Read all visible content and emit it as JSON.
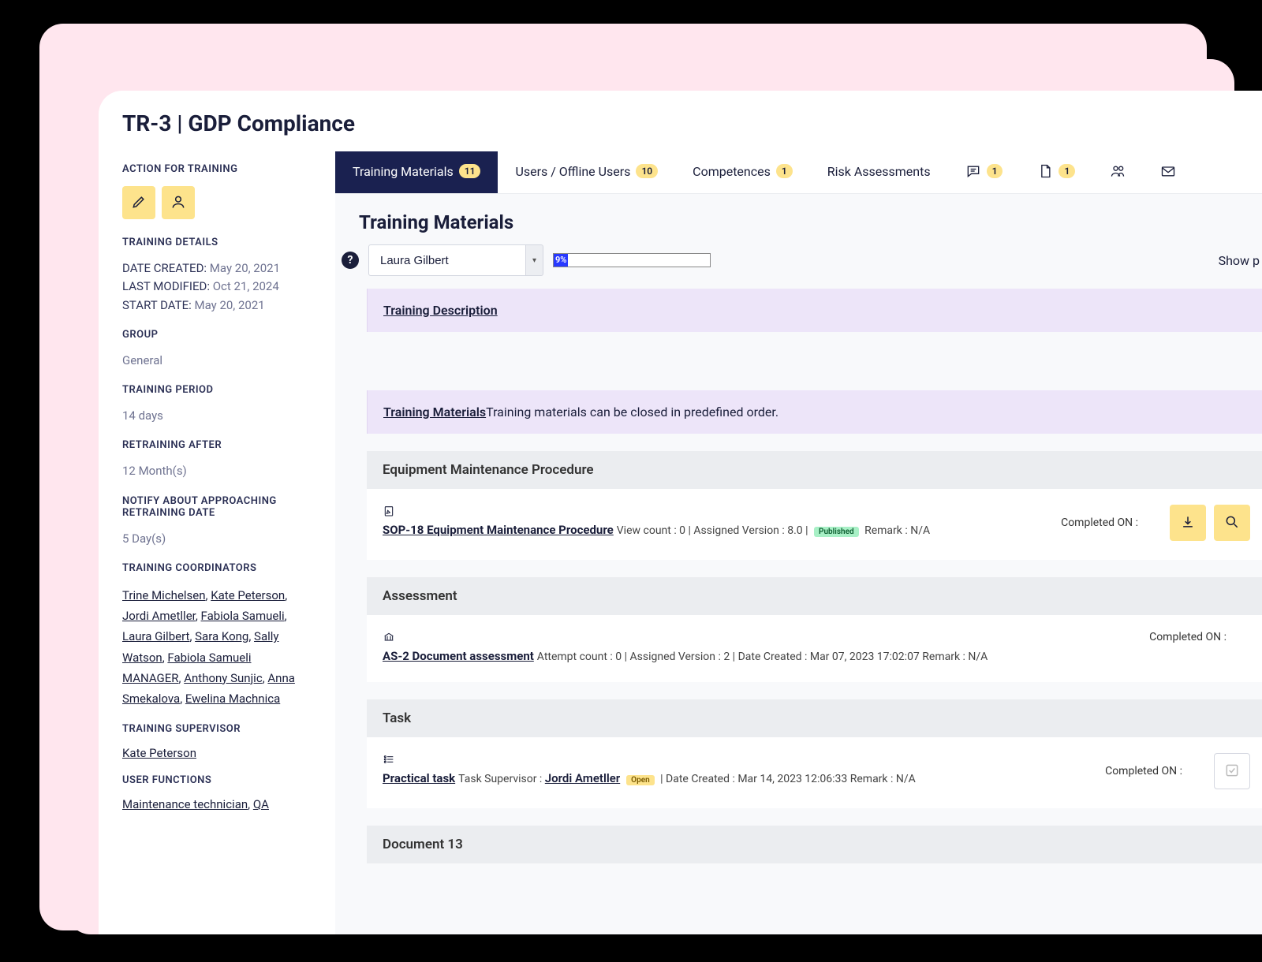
{
  "page_title": "TR-3 | GDP Compliance",
  "sidebar": {
    "action_heading": "ACTION FOR TRAINING",
    "details_heading": "TRAINING DETAILS",
    "date_created_label": "DATE CREATED:",
    "date_created": "May 20, 2021",
    "last_modified_label": "LAST MODIFIED:",
    "last_modified": "Oct 21, 2024",
    "start_date_label": "START DATE:",
    "start_date": "May 20, 2021",
    "group_label": "GROUP",
    "group": "General",
    "period_label": "TRAINING PERIOD",
    "period": "14 days",
    "retrain_label": "RETRAINING AFTER",
    "retrain": "12 Month(s)",
    "notify_label": "NOTIFY ABOUT APPROACHING RETRAINING DATE",
    "notify": "5 Day(s)",
    "coord_label": "TRAINING COORDINATORS",
    "coordinators": [
      "Trine Michelsen",
      "Kate Peterson",
      "Jordi Ametller",
      "Fabiola Samueli",
      "Laura Gilbert",
      "Sara Kong",
      "Sally Watson",
      "Fabiola Samueli MANAGER",
      "Anthony Sunjic",
      "Anna Smekalova",
      "Ewelina Machnica"
    ],
    "supervisor_label": "TRAINING SUPERVISOR",
    "supervisor": "Kate Peterson",
    "user_func_label": "USER FUNCTIONS",
    "user_funcs": [
      "Maintenance technician",
      "QA"
    ]
  },
  "tabs": [
    {
      "label": "Training Materials",
      "badge": "11",
      "active": true
    },
    {
      "label": "Users / Offline Users",
      "badge": "10"
    },
    {
      "label": "Competences",
      "badge": "1"
    },
    {
      "label": "Risk Assessments"
    },
    {
      "icon": "chat",
      "badge": "1"
    },
    {
      "icon": "doc",
      "badge": "1"
    },
    {
      "icon": "users"
    },
    {
      "icon": "mail"
    }
  ],
  "main": {
    "section_title": "Training Materials",
    "selected_user": "Laura Gilbert",
    "progress_pct": "9%",
    "show_link": "Show p",
    "training_desc_label": "Training Description",
    "materials_link": "Training Materials",
    "materials_note": "Training materials can be closed in predefined order.",
    "categories": [
      {
        "title": "Equipment Maintenance Procedure",
        "icon": "edit",
        "item_title": "SOP-18 Equipment Maintenance Procedure",
        "meta_before": "View count : 0 | Assigned Version : 8.0 | ",
        "pill": "Published",
        "pill_type": "pub",
        "meta_after": " Remark : N/A",
        "completed": "Completed ON :",
        "buttons": [
          "download",
          "search"
        ]
      },
      {
        "title": "Assessment",
        "icon": "bank",
        "item_title": "AS-2 Document assessment",
        "meta_before": "Attempt count : 0 | Assigned Version : 2 | Date Created : Mar 07, 2023 17:02:07 Remark : N/A",
        "completed": "Completed ON :",
        "buttons": []
      },
      {
        "title": "Task",
        "icon": "list",
        "item_title": "Practical task",
        "supervisor_label": "Task Supervisor : ",
        "supervisor": "Jordi Ametller",
        "pill": "Open",
        "pill_type": "open",
        "meta_after": " | Date Created : Mar 14, 2023 12:06:33 Remark : N/A",
        "completed": "Completed ON :",
        "buttons": [
          "check-ghost"
        ]
      },
      {
        "title": "Document 13"
      }
    ]
  }
}
